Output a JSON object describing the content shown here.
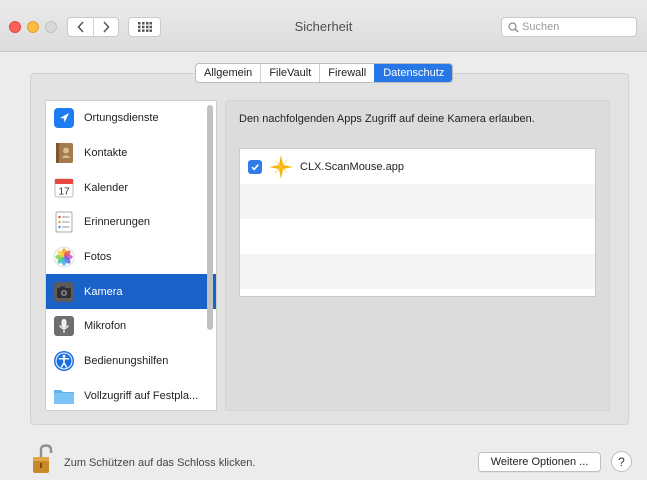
{
  "window": {
    "title": "Sicherheit",
    "search_placeholder": "Suchen"
  },
  "tabs": [
    {
      "label": "Allgemein",
      "active": false
    },
    {
      "label": "FileVault",
      "active": false
    },
    {
      "label": "Firewall",
      "active": false
    },
    {
      "label": "Datenschutz",
      "active": true
    }
  ],
  "sidebar": {
    "items": [
      {
        "label": "Ortungsdienste",
        "icon": "location-arrow-icon"
      },
      {
        "label": "Kontakte",
        "icon": "contacts-book-icon"
      },
      {
        "label": "Kalender",
        "icon": "calendar-icon",
        "icon_text": "17"
      },
      {
        "label": "Erinnerungen",
        "icon": "reminders-icon"
      },
      {
        "label": "Fotos",
        "icon": "photos-icon"
      },
      {
        "label": "Kamera",
        "icon": "camera-icon",
        "selected": true
      },
      {
        "label": "Mikrofon",
        "icon": "microphone-icon"
      },
      {
        "label": "Bedienungshilfen",
        "icon": "accessibility-icon"
      },
      {
        "label": "Vollzugriff auf Festpla...",
        "icon": "folder-icon"
      }
    ]
  },
  "main": {
    "description": "Den nachfolgenden Apps Zugriff auf deine Kamera erlauben.",
    "apps": [
      {
        "name": "CLX.ScanMouse.app",
        "checked": true
      }
    ]
  },
  "footer": {
    "lock_text": "Zum Schützen auf das Schloss klicken.",
    "options_label": "Weitere Optionen ...",
    "help_label": "?"
  },
  "colors": {
    "accent": "#2877e6",
    "selection": "#1a61c8"
  }
}
